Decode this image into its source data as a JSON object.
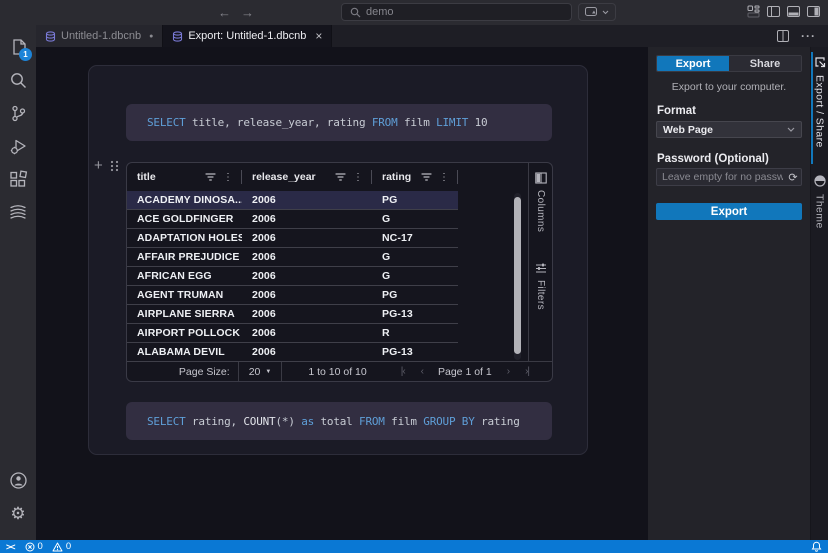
{
  "icons": {
    "back": "←",
    "forward": "→",
    "kebab": "⋮",
    "modified_dot": "●",
    "close": "×",
    "more_actions": "···",
    "settings": "⚙",
    "page_size_arrow": "▼",
    "first_page": "|‹",
    "prev_page": "‹",
    "next_page": "›",
    "last_page": "›|",
    "plus": "+",
    "remote": "><",
    "password_generate": "⟳"
  },
  "title_bar": {
    "search_value": "demo"
  },
  "tab_bar": {
    "tabs": [
      {
        "label": "Untitled-1.dbcnb",
        "state": "modified",
        "active": false
      },
      {
        "label": "Export: Untitled-1.dbcnb",
        "state": "closeable",
        "active": true
      }
    ]
  },
  "activity_bar": {
    "badge": "1"
  },
  "notebook": {
    "sql_cells": [
      {
        "tokens": [
          {
            "text": "SELECT",
            "type": "kw"
          },
          {
            "text": " title, release_year, rating ",
            "type": "plain"
          },
          {
            "text": "FROM",
            "type": "kw"
          },
          {
            "text": " film ",
            "type": "plain"
          },
          {
            "text": "LIMIT",
            "type": "kw"
          },
          {
            "text": " 10",
            "type": "plain"
          }
        ]
      },
      {
        "tokens": [
          {
            "text": "SELECT",
            "type": "kw"
          },
          {
            "text": " rating, ",
            "type": "plain"
          },
          {
            "text": "COUNT",
            "type": "fn"
          },
          {
            "text": "(*) ",
            "type": "plain"
          },
          {
            "text": "as",
            "type": "kw"
          },
          {
            "text": " total ",
            "type": "plain"
          },
          {
            "text": "FROM",
            "type": "kw"
          },
          {
            "text": " film ",
            "type": "plain"
          },
          {
            "text": "GROUP BY",
            "type": "kw"
          },
          {
            "text": " rating",
            "type": "plain"
          }
        ]
      }
    ]
  },
  "grid": {
    "columns": [
      "title",
      "release_year",
      "rating"
    ],
    "rows": [
      [
        "ACADEMY DINOSA...",
        "2006",
        "PG"
      ],
      [
        "ACE GOLDFINGER",
        "2006",
        "G"
      ],
      [
        "ADAPTATION HOLES",
        "2006",
        "NC-17"
      ],
      [
        "AFFAIR PREJUDICE",
        "2006",
        "G"
      ],
      [
        "AFRICAN EGG",
        "2006",
        "G"
      ],
      [
        "AGENT TRUMAN",
        "2006",
        "PG"
      ],
      [
        "AIRPLANE SIERRA",
        "2006",
        "PG-13"
      ],
      [
        "AIRPORT POLLOCK",
        "2006",
        "R"
      ],
      [
        "ALABAMA DEVIL",
        "2006",
        "PG-13"
      ]
    ],
    "selected_row_index": 0,
    "tool_panels": {
      "columns": "Columns",
      "filters": "Filters"
    },
    "pagination": {
      "page_size_label": "Page Size:",
      "page_size": "20",
      "range": "1 to 10 of 10",
      "page": "Page 1 of 1"
    }
  },
  "export_panel": {
    "tabs": {
      "export": "Export",
      "share": "Share"
    },
    "caption": "Export to your computer.",
    "format_label": "Format",
    "format_value": "Web Page",
    "password_label": "Password (Optional)",
    "password_placeholder": "Leave empty for no password protection",
    "export_button": "Export"
  },
  "right_strip": {
    "export_share": "Export / Share",
    "theme": "Theme"
  },
  "status_bar": {
    "errors": "0",
    "warnings": "0"
  },
  "colors": {
    "accent": "#1177bb",
    "statusbar_blue": "#0a78d4",
    "keyword_blue": "#5f9fd8",
    "db_icon_purple": "#7a7ad6"
  }
}
